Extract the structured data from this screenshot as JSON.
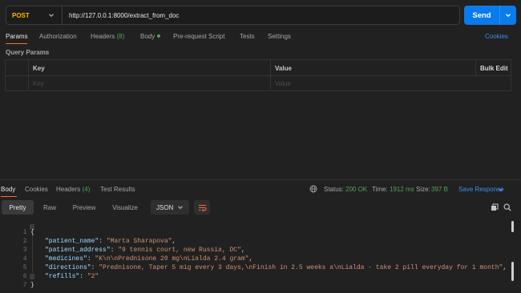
{
  "request": {
    "method": "POST",
    "url": "http://127.0.0.1:8000/extract_from_doc",
    "send_label": "Send"
  },
  "request_tabs": [
    {
      "label": "Params"
    },
    {
      "label": "Authorization"
    },
    {
      "label": "Headers",
      "count": "(8)"
    },
    {
      "label": "Body"
    },
    {
      "label": "Pre-request Script"
    },
    {
      "label": "Tests"
    },
    {
      "label": "Settings"
    }
  ],
  "cookies_link": "Cookies",
  "query_params": {
    "title": "Query Params",
    "col_key": "Key",
    "col_value": "Value",
    "bulk_edit": "Bulk Edit",
    "key_placeholder": "Key",
    "value_placeholder": "Value"
  },
  "response_tabs": [
    {
      "label": "Body"
    },
    {
      "label": "Cookies"
    },
    {
      "label": "Headers",
      "count": "(4)"
    },
    {
      "label": "Test Results"
    }
  ],
  "response_meta": {
    "status_label": "Status:",
    "status_value": "200 OK",
    "time_label": "Time:",
    "time_value": "1912 ms",
    "size_label": "Size:",
    "size_value": "397 B",
    "save_label": "Save Response"
  },
  "view_modes": [
    "Pretty",
    "Raw",
    "Preview",
    "Visualize"
  ],
  "format": "JSON",
  "code_lines": [
    {
      "n": "1",
      "open": "{"
    },
    {
      "n": "2",
      "key": "\"patient_name\"",
      "value": "\"Marta Sharapova\"",
      "comma": ","
    },
    {
      "n": "3",
      "key": "\"patient_address\"",
      "value": "\"9 tennis court, new Russia, DC\"",
      "comma": ","
    },
    {
      "n": "4",
      "key": "\"medicines\"",
      "value": "\"K\\n\\nPrednisone 20 mg\\nLialda 2.4 gram\"",
      "comma": ","
    },
    {
      "n": "5",
      "key": "\"directions\"",
      "value": "\"Prednisone, Taper 5 mig every 3 days,\\nFinish in 2.5 weeks a\\nLialda - take 2 pill everyday for 1 month\"",
      "comma": ","
    },
    {
      "n": "6",
      "key": "\"refills\"",
      "value": "\"2\"",
      "comma": ""
    },
    {
      "n": "7",
      "open": "}"
    }
  ],
  "icons": {
    "method_dropdown": "chevron-down-icon",
    "send_dropdown": "chevron-down-icon",
    "globe": "globe-icon",
    "wrap": "wrap-lines-icon",
    "copy": "copy-icon",
    "search": "search-icon"
  },
  "colors": {
    "background": "#212121",
    "method": "#ffb400",
    "send": "#097bed",
    "link": "#3d8eef",
    "status_ok": "#49a55a",
    "active_tab_underline": "#ff6c37",
    "json_key": "#9cdcfe",
    "json_string": "#ce9178"
  }
}
